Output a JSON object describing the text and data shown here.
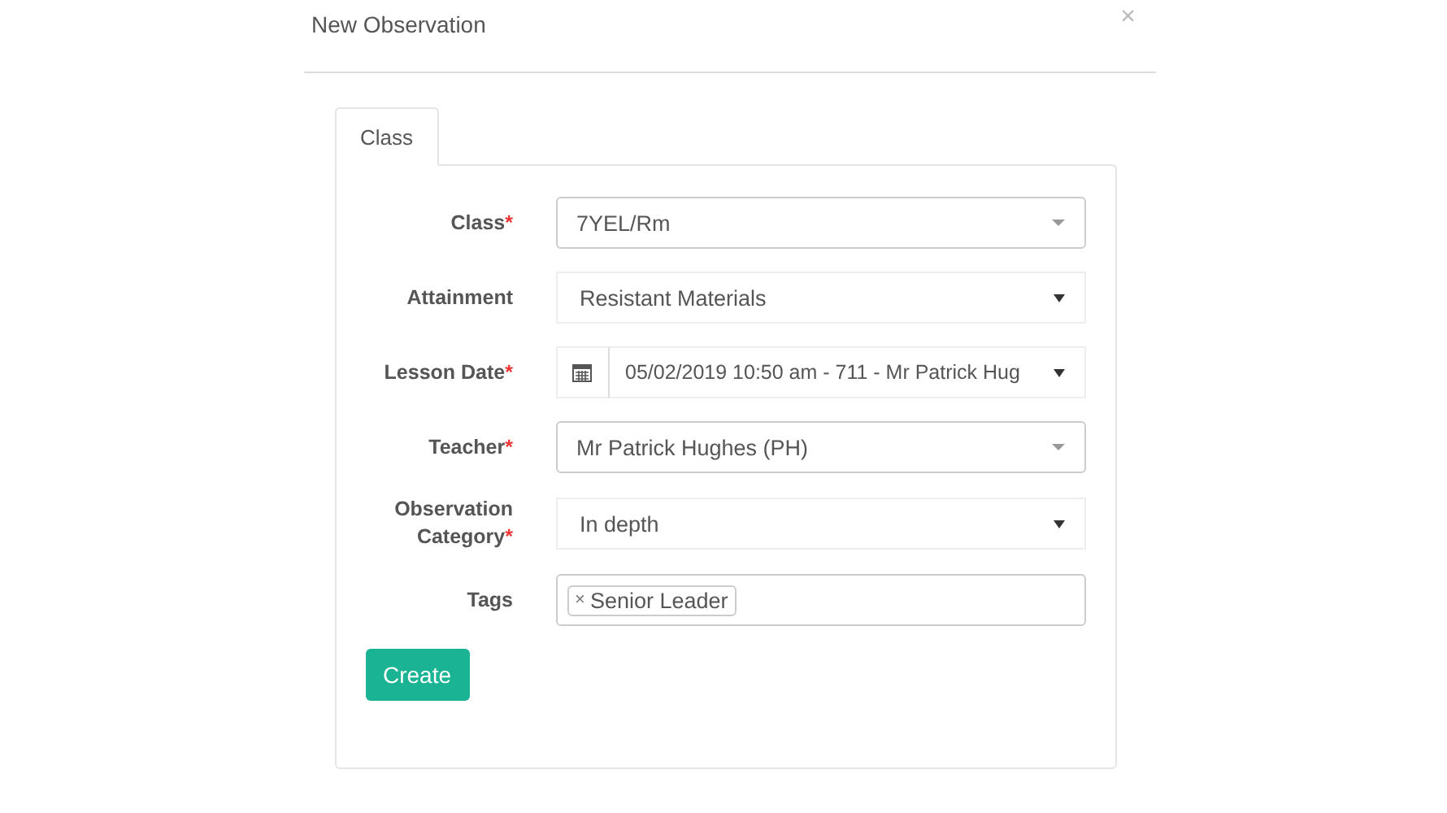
{
  "dialog": {
    "title": "New Observation",
    "close": "×"
  },
  "tabs": [
    {
      "label": "Class",
      "selected": true
    }
  ],
  "fields": [
    {
      "kind": "combo",
      "label": "Class",
      "mark": "*",
      "value": "7YEL/Rm"
    },
    {
      "kind": "select",
      "label": "Attainment",
      "value": "Resistant Materials"
    },
    {
      "kind": "date",
      "label": "Lesson Date",
      "mark": "*",
      "value": "05/02/2019 10:50 am - 711 - Mr Patrick Hug"
    },
    {
      "kind": "combo",
      "label": "Teacher",
      "mark": "*",
      "value": "Mr Patrick Hughes (PH)"
    },
    {
      "kind": "select",
      "label": "Observation Category",
      "mark": "*",
      "value": "In depth"
    },
    {
      "kind": "tags",
      "label": "Tags",
      "tags": [
        {
          "remove": "×",
          "label": "Senior Leader"
        }
      ]
    }
  ],
  "submit": "Create"
}
